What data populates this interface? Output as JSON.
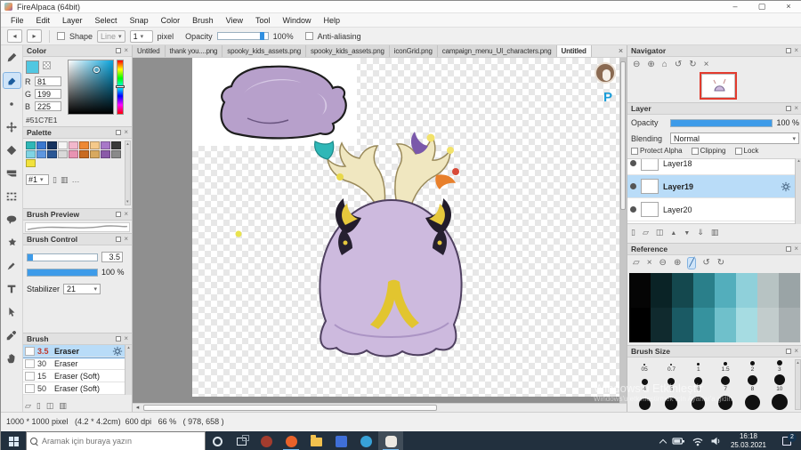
{
  "window": {
    "title": "FireAlpaca (64bit)"
  },
  "menubar": {
    "items": [
      "File",
      "Edit",
      "Layer",
      "Select",
      "Snap",
      "Color",
      "Brush",
      "View",
      "Tool",
      "Window",
      "Help"
    ]
  },
  "toolbar": {
    "shape_label": "Shape",
    "shape_value": "Line",
    "width_value": "1",
    "width_unit": "pixel",
    "opacity_label": "Opacity",
    "opacity_value": "100%",
    "antialiasing_label": "Anti-aliasing"
  },
  "tabs": {
    "items": [
      {
        "label": "Untitled",
        "active": false
      },
      {
        "label": "thank you....png",
        "active": false
      },
      {
        "label": "spooky_kids_assets.png",
        "active": false
      },
      {
        "label": "spooky_kids_assets.png",
        "active": false
      },
      {
        "label": "iconGrid.png",
        "active": false
      },
      {
        "label": "campaign_menu_UI_characters.png",
        "active": false
      },
      {
        "label": "Untitled",
        "active": true
      }
    ]
  },
  "tools": {
    "items": [
      "brush",
      "eraser",
      "dot",
      "move",
      "fill",
      "gradient",
      "select",
      "lasso",
      "magic-wand",
      "select-pen",
      "text",
      "operation",
      "eyedropper",
      "hand"
    ],
    "selected": "eraser"
  },
  "color_panel": {
    "title": "Color",
    "channels": [
      {
        "label": "R",
        "value": "81"
      },
      {
        "label": "G",
        "value": "199"
      },
      {
        "label": "B",
        "value": "225"
      }
    ],
    "hex": "#51C7E1",
    "current_color": "#51C7E1"
  },
  "palette_panel": {
    "title": "Palette",
    "set_label": "#1",
    "colors": [
      "#2fb7b7",
      "#3a78d0",
      "#16335f",
      "#f5f5f5",
      "#f2b8cc",
      "#ee8833",
      "#f5c98a",
      "#a878c8",
      "#3a3a3a",
      "#7fd4e4",
      "#5e97e0",
      "#2a5795",
      "#d9d9d9",
      "#e893b2",
      "#c86a21",
      "#d8a95f",
      "#8a5aa8",
      "#8a8a8a",
      "#f2e23c"
    ]
  },
  "brush_preview_panel": {
    "title": "Brush Preview"
  },
  "brush_control_panel": {
    "title": "Brush Control",
    "size_value": "3.5",
    "opacity_value": "100 %",
    "stabilizer_label": "Stabilizer",
    "stabilizer_value": "21"
  },
  "brush_panel": {
    "title": "Brush",
    "items": [
      {
        "size": "3.5",
        "name": "Eraser",
        "selected": true
      },
      {
        "size": "30",
        "name": "Eraser",
        "selected": false
      },
      {
        "size": "15",
        "name": "Eraser (Soft)",
        "selected": false
      },
      {
        "size": "50",
        "name": "Eraser (Soft)",
        "selected": false
      }
    ]
  },
  "navigator_panel": {
    "title": "Navigator"
  },
  "layer_panel": {
    "title": "Layer",
    "opacity_label": "Opacity",
    "opacity_value": "100 %",
    "blending_label": "Blending",
    "blending_value": "Normal",
    "checkboxes": [
      "Protect Alpha",
      "Clipping",
      "Lock"
    ],
    "layers": [
      {
        "name": "Layer18",
        "selected": false
      },
      {
        "name": "Layer19",
        "selected": true
      },
      {
        "name": "Layer20",
        "selected": false
      }
    ]
  },
  "reference_panel": {
    "title": "Reference",
    "cells": [
      [
        "#050505",
        "#0a2326",
        "#14484e",
        "#2a7f8a",
        "#53aebc",
        "#8fd0da",
        "#b7c3c3",
        "#9aa4a6"
      ],
      [
        "#000000",
        "#102a2e",
        "#1a5a64",
        "#36929e",
        "#6fc0cb",
        "#a6dce2",
        "#c2cccc",
        "#a8b0b2"
      ]
    ]
  },
  "brush_size_panel": {
    "title": "Brush Size",
    "rows": [
      {
        "labels": [
          "05",
          "0.7",
          "1",
          "1.5",
          "2",
          "3"
        ],
        "dots": [
          2,
          2,
          3,
          4,
          5,
          6
        ]
      },
      {
        "labels": [
          "4",
          "5",
          "6",
          "7",
          "8",
          "10"
        ],
        "dots": [
          7,
          8,
          9,
          10,
          11,
          12
        ]
      },
      {
        "labels": [
          "",
          "",
          "",
          "",
          "",
          ""
        ],
        "dots": [
          13,
          14,
          15,
          16,
          17,
          18
        ]
      }
    ]
  },
  "canvas": {
    "zoom": "66 %",
    "paypal_label": "P"
  },
  "status_bar": {
    "text": "1000 * 1000 pixel   (4.2 * 4.2cm)  600 dpi   66 %   ( 978, 658 )"
  },
  "watermark": {
    "line1": "Windows'u Etkinleştir",
    "line2": "Windows'u etkinleştirmek için Ayarlar'a gidin."
  },
  "taskbar": {
    "search_placeholder": "Aramak için buraya yazın",
    "time": "16:18",
    "date": "25.03.2021",
    "badge": "2",
    "apps": [
      {
        "name": "app-red",
        "color": "#a33c2e",
        "shape": "circle",
        "running": false,
        "active": false
      },
      {
        "name": "firefox",
        "color": "#e8622a",
        "shape": "circle",
        "running": true,
        "active": false
      },
      {
        "name": "explorer",
        "color": "#f2c14e",
        "shape": "folder",
        "running": false,
        "active": false
      },
      {
        "name": "mail",
        "color": "#3f6fd8",
        "shape": "square",
        "running": false,
        "active": false
      },
      {
        "name": "edge",
        "color": "#38a2d8",
        "shape": "circle",
        "running": false,
        "active": false
      },
      {
        "name": "firealpaca",
        "color": "#ece8e2",
        "shape": "blob",
        "running": true,
        "active": true
      }
    ]
  }
}
